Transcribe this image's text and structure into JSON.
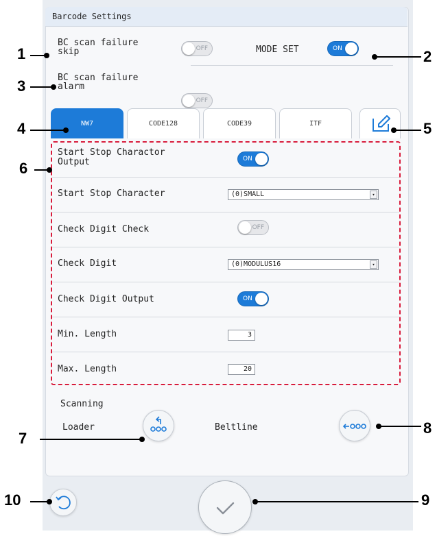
{
  "panel": {
    "title": "Barcode Settings"
  },
  "top_settings": {
    "bc_scan_failure_skip": {
      "label_line1": "BC scan failure",
      "label_line2": "skip",
      "state_text": "OFF",
      "on": false
    },
    "mode_set": {
      "label": "MODE SET",
      "state_text": "ON",
      "on": true
    },
    "bc_scan_failure_alarm": {
      "label_line1": "BC scan failure",
      "label_line2": "alarm",
      "state_text": "OFF",
      "on": false
    }
  },
  "tabs": [
    {
      "label": "NW7",
      "active": true
    },
    {
      "label": "CODE128",
      "active": false
    },
    {
      "label": "CODE39",
      "active": false
    },
    {
      "label": "ITF",
      "active": false
    }
  ],
  "edit_tab": {
    "icon": "edit-icon"
  },
  "rows": {
    "start_stop_output": {
      "label_line1": "Start Stop Charactor",
      "label_line2": "Output",
      "state_text": "ON",
      "on": true
    },
    "start_stop_character": {
      "label": "Start Stop Character",
      "value": "(0)SMALL"
    },
    "check_digit_check": {
      "label": "Check Digit Check",
      "state_text": "OFF",
      "on": false
    },
    "check_digit": {
      "label": "Check Digit",
      "value": "(0)MODULUS16"
    },
    "check_digit_output": {
      "label": "Check Digit Output",
      "state_text": "ON",
      "on": true
    },
    "min_length": {
      "label": "Min. Length",
      "value": "3"
    },
    "max_length": {
      "label": "Max. Length",
      "value": "20"
    }
  },
  "scanning": {
    "title": "Scanning",
    "loader_label": "Loader",
    "beltline_label": "Beltline",
    "loader_icon": "loader-return-icon",
    "beltline_icon": "beltline-arrow-icon"
  },
  "footer": {
    "back_icon": "back-arrow-icon",
    "confirm_icon": "checkmark-icon"
  },
  "callouts": [
    "1",
    "2",
    "3",
    "4",
    "5",
    "6",
    "7",
    "8",
    "9",
    "10"
  ],
  "colors": {
    "accent": "#1d7bd8",
    "highlight_dash": "#d81b3b",
    "panel_bg": "#f7f8fa",
    "device_bg": "#e9edf2"
  }
}
